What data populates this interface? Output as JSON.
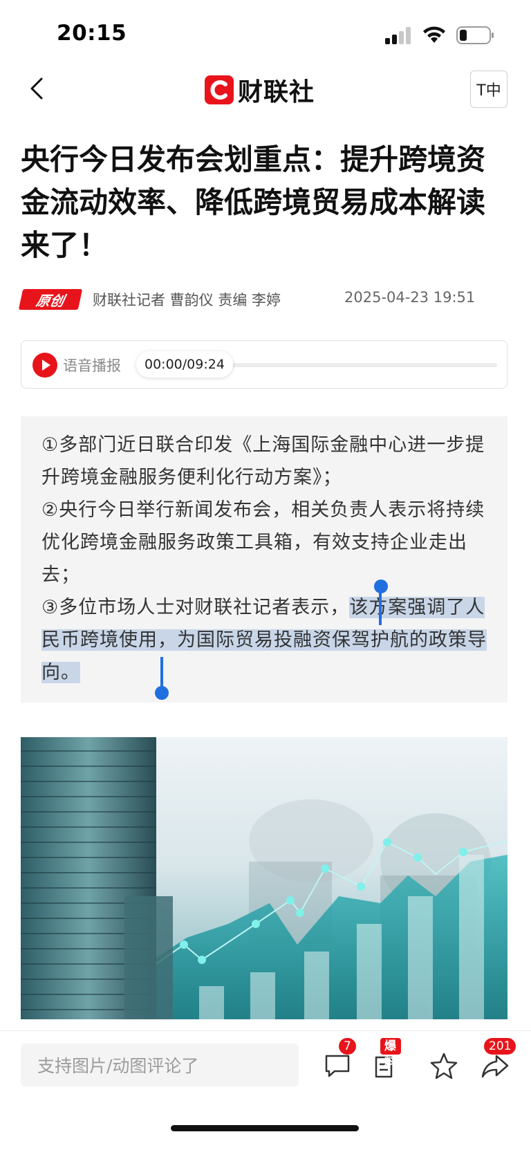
{
  "status_bar": {
    "time": "20:15"
  },
  "nav": {
    "logo_text": "财联社",
    "font_button": "T中"
  },
  "article": {
    "headline": "央行今日发布会划重点：提升跨境资金流动效率、降低跨境贸易成本解读来了！",
    "badge": "原创",
    "reporter": "财联社记者 曹韵仪  责编 李婷",
    "publish_time": "2025-04-23 19:51",
    "audio": {
      "label": "语音播报",
      "time": "00:00/09:24",
      "progress": 0
    },
    "summary": {
      "p1": "①多部门近日联合印发《上海国际金融中心进一步提升跨境金融服务便利化行动方案》；",
      "p2": "②央行今日举行新闻发布会，相关负责人表示将持续优化跨境金融服务政策工具箱，有效支持企业走出去；",
      "p3_prefix": "③多位市场人士对财联社记者表示，",
      "p3_selected": "该方案强调了人民币跨境使用，为国际贸易投融资保驾护航的政策导向。"
    }
  },
  "bottom_bar": {
    "comment_placeholder": "支持图片/动图评论了",
    "comment_count": "7",
    "tip_label": "爆料",
    "share_count": "201"
  },
  "colors": {
    "brand_red": "#e8141b",
    "selection_blue": "#1f6fe0",
    "selection_bg": "#c8d6e8"
  },
  "icons": [
    "back-icon",
    "cellular-signal-icon",
    "wifi-icon",
    "battery-icon",
    "play-icon",
    "comment-icon",
    "tip-off-icon",
    "star-icon",
    "share-icon"
  ]
}
